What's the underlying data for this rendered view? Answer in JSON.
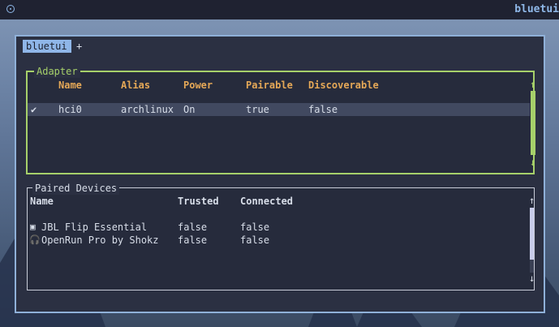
{
  "topbar": {
    "window_title": "bluetui"
  },
  "tabs": {
    "active": "bluetui",
    "new_tab": "+"
  },
  "adapter": {
    "title": "Adapter",
    "columns": [
      "Name",
      "Alias",
      "Power",
      "Pairable",
      "Discoverable"
    ],
    "rows": [
      {
        "selected_mark": "✔",
        "name": "hci0",
        "alias": "archlinux",
        "power": "On",
        "pairable": "true",
        "discoverable": "false"
      }
    ],
    "scroll_up": "↑",
    "scroll_down": "↓"
  },
  "paired": {
    "title": "Paired Devices",
    "columns": [
      "Name",
      "Trusted",
      "Connected"
    ],
    "rows": [
      {
        "icon": "speaker-icon",
        "glyph": "▣",
        "name": "JBL Flip Essential",
        "trusted": "false",
        "connected": "false"
      },
      {
        "icon": "headphones-icon",
        "glyph": "🎧",
        "name": "OpenRun Pro by Shokz",
        "trusted": "false",
        "connected": "false"
      }
    ],
    "scroll_up": "↑",
    "scroll_down": "↓"
  },
  "colors": {
    "accent_green": "#a6d06a",
    "header_orange": "#e5a857",
    "tab_blue": "#8fb6e8",
    "terminal_bg": "#2b3042"
  }
}
